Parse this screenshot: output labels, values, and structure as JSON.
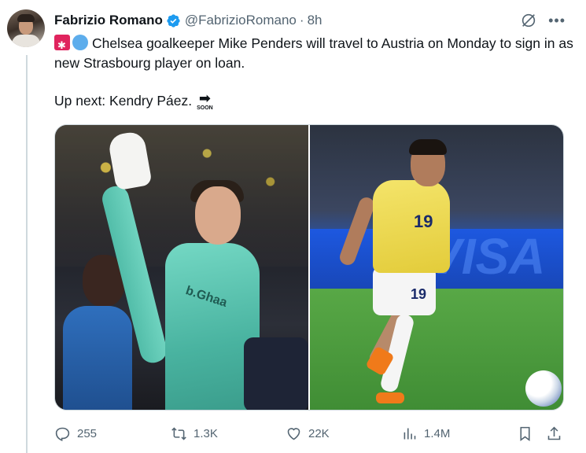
{
  "author": {
    "name": "Fabrizio Romano",
    "handle": "@FabrizioRomano",
    "separator": "·",
    "time": "8h"
  },
  "icons": {
    "verified": "verified-badge-icon",
    "grok": "grok-icon",
    "more": "more-icon"
  },
  "tweet": {
    "text": "Chelsea goalkeeper Mike Penders will travel to Austria on Monday to sign in as new Strasbourg player on loan.",
    "next": "Up next: Kendry Páez.",
    "soon_arrow": "➡",
    "soon_word": "SOON"
  },
  "media": {
    "left_logo": "b.Ghaa",
    "right_board": "VISA",
    "right_number": "19"
  },
  "actions": {
    "replies": "255",
    "reposts": "1.3K",
    "likes": "22K",
    "views": "1.4M"
  },
  "colors": {
    "accent": "#1d9bf0",
    "muted": "#536471",
    "text": "#0f1419"
  }
}
